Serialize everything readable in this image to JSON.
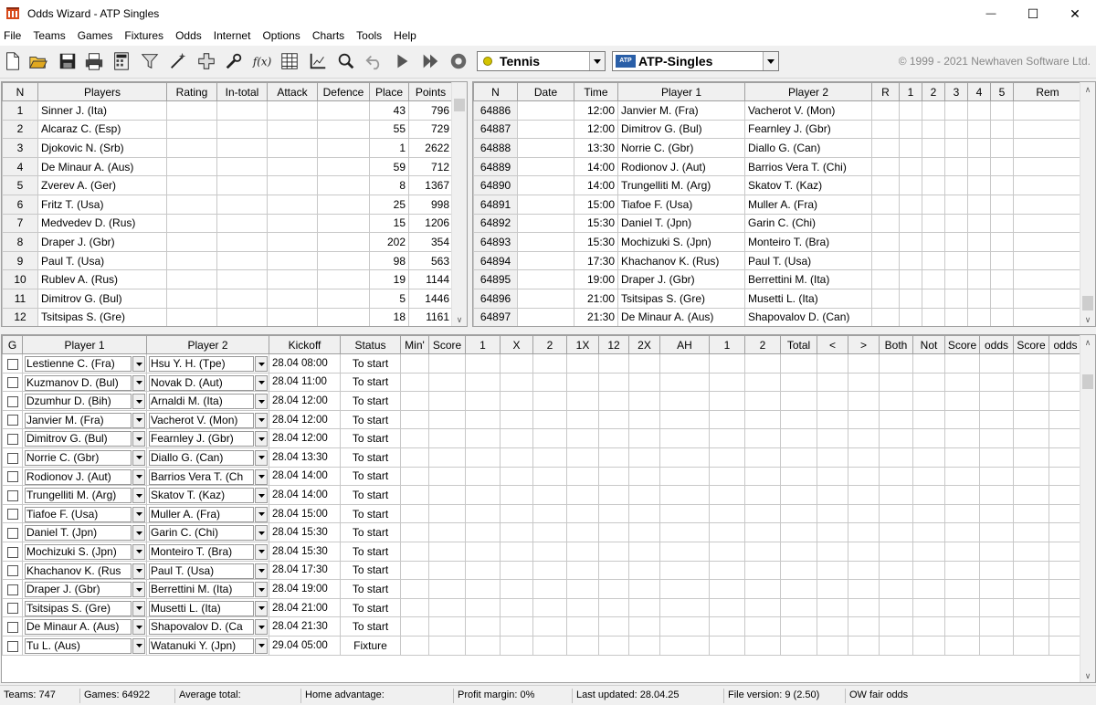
{
  "window": {
    "title": "Odds Wizard - ATP Singles",
    "minimize_glyph": "—",
    "maximize_glyph": "☐",
    "close_glyph": "✕"
  },
  "menu": [
    "File",
    "Teams",
    "Games",
    "Fixtures",
    "Odds",
    "Internet",
    "Options",
    "Charts",
    "Tools",
    "Help"
  ],
  "toolbar": {
    "icons": [
      "new-file-icon",
      "open-folder-icon",
      "save-icon",
      "print-icon",
      "calculator-icon",
      "filter-icon",
      "magic-wand-icon",
      "add-icon",
      "tools-icon",
      "formula-icon",
      "table-icon",
      "graph-icon",
      "search-icon",
      "undo-icon",
      "play-icon",
      "fast-forward-icon",
      "settings-icon"
    ],
    "sport_select": "Tennis",
    "league_select": "ATP-Singles",
    "league_badge": "ATP",
    "copyright": "© 1999 - 2021 Newhaven Software Ltd."
  },
  "teams_table": {
    "headers": [
      "N",
      "Players",
      "Rating",
      "In-total",
      "Attack",
      "Defence",
      "Place",
      "Points"
    ],
    "rows": [
      [
        "1",
        "Sinner J. (Ita)",
        "",
        "",
        "",
        "",
        "43",
        "796"
      ],
      [
        "2",
        "Alcaraz C. (Esp)",
        "",
        "",
        "",
        "",
        "55",
        "729"
      ],
      [
        "3",
        "Djokovic N. (Srb)",
        "",
        "",
        "",
        "",
        "1",
        "2622"
      ],
      [
        "4",
        "De Minaur A. (Aus)",
        "",
        "",
        "",
        "",
        "59",
        "712"
      ],
      [
        "5",
        "Zverev A. (Ger)",
        "",
        "",
        "",
        "",
        "8",
        "1367"
      ],
      [
        "6",
        "Fritz T. (Usa)",
        "",
        "",
        "",
        "",
        "25",
        "998"
      ],
      [
        "7",
        "Medvedev D. (Rus)",
        "",
        "",
        "",
        "",
        "15",
        "1206"
      ],
      [
        "8",
        "Draper J. (Gbr)",
        "",
        "",
        "",
        "",
        "202",
        "354"
      ],
      [
        "9",
        "Paul T. (Usa)",
        "",
        "",
        "",
        "",
        "98",
        "563"
      ],
      [
        "10",
        "Rublev A. (Rus)",
        "",
        "",
        "",
        "",
        "19",
        "1144"
      ],
      [
        "11",
        "Dimitrov G. (Bul)",
        "",
        "",
        "",
        "",
        "5",
        "1446"
      ],
      [
        "12",
        "Tsitsipas S. (Gre)",
        "",
        "",
        "",
        "",
        "18",
        "1161"
      ]
    ]
  },
  "games_table": {
    "headers": [
      "N",
      "Date",
      "Time",
      "Player 1",
      "Player 2",
      "R",
      "1",
      "2",
      "3",
      "4",
      "5",
      "Rem"
    ],
    "rows": [
      [
        "64886",
        "",
        "12:00",
        "Janvier M. (Fra)",
        "Vacherot V. (Mon)"
      ],
      [
        "64887",
        "",
        "12:00",
        "Dimitrov G. (Bul)",
        "Fearnley J. (Gbr)"
      ],
      [
        "64888",
        "",
        "13:30",
        "Norrie C. (Gbr)",
        "Diallo G. (Can)"
      ],
      [
        "64889",
        "",
        "14:00",
        "Rodionov J. (Aut)",
        "Barrios Vera T. (Chi)"
      ],
      [
        "64890",
        "",
        "14:00",
        "Trungelliti M. (Arg)",
        "Skatov T. (Kaz)"
      ],
      [
        "64891",
        "",
        "15:00",
        "Tiafoe F. (Usa)",
        "Muller A. (Fra)"
      ],
      [
        "64892",
        "",
        "15:30",
        "Daniel T. (Jpn)",
        "Garin C. (Chi)"
      ],
      [
        "64893",
        "",
        "15:30",
        "Mochizuki S. (Jpn)",
        "Monteiro T. (Bra)"
      ],
      [
        "64894",
        "",
        "17:30",
        "Khachanov K. (Rus)",
        "Paul T. (Usa)"
      ],
      [
        "64895",
        "",
        "19:00",
        "Draper J. (Gbr)",
        "Berrettini M. (Ita)"
      ],
      [
        "64896",
        "",
        "21:00",
        "Tsitsipas S. (Gre)",
        "Musetti L. (Ita)"
      ],
      [
        "64897",
        "",
        "21:30",
        "De Minaur A. (Aus)",
        "Shapovalov D. (Can)"
      ]
    ]
  },
  "fixtures_table": {
    "headers": [
      "G",
      "Player 1",
      "Player 2",
      "Kickoff",
      "Status",
      "Min'",
      "Score",
      "1",
      "X",
      "2",
      "1X",
      "12",
      "2X",
      "AH",
      "1",
      "2",
      "Total",
      "<",
      ">",
      "Both",
      "Not",
      "Score",
      "odds",
      "Score",
      "odds"
    ],
    "rows": [
      [
        "Lestienne C. (Fra)",
        "Hsu Y. H. (Tpe)",
        "28.04 08:00",
        "To start"
      ],
      [
        "Kuzmanov D. (Bul)",
        "Novak D. (Aut)",
        "28.04 11:00",
        "To start"
      ],
      [
        "Dzumhur D. (Bih)",
        "Arnaldi M. (Ita)",
        "28.04 12:00",
        "To start"
      ],
      [
        "Janvier M. (Fra)",
        "Vacherot V. (Mon)",
        "28.04 12:00",
        "To start"
      ],
      [
        "Dimitrov G. (Bul)",
        "Fearnley J. (Gbr)",
        "28.04 12:00",
        "To start"
      ],
      [
        "Norrie C. (Gbr)",
        "Diallo G. (Can)",
        "28.04 13:30",
        "To start"
      ],
      [
        "Rodionov J. (Aut)",
        "Barrios Vera T. (Ch",
        "28.04 14:00",
        "To start"
      ],
      [
        "Trungelliti M. (Arg)",
        "Skatov T. (Kaz)",
        "28.04 14:00",
        "To start"
      ],
      [
        "Tiafoe F. (Usa)",
        "Muller A. (Fra)",
        "28.04 15:00",
        "To start"
      ],
      [
        "Daniel T. (Jpn)",
        "Garin C. (Chi)",
        "28.04 15:30",
        "To start"
      ],
      [
        "Mochizuki S. (Jpn)",
        "Monteiro T. (Bra)",
        "28.04 15:30",
        "To start"
      ],
      [
        "Khachanov K. (Rus",
        "Paul T. (Usa)",
        "28.04 17:30",
        "To start"
      ],
      [
        "Draper J. (Gbr)",
        "Berrettini M. (Ita)",
        "28.04 19:00",
        "To start"
      ],
      [
        "Tsitsipas S. (Gre)",
        "Musetti L. (Ita)",
        "28.04 21:00",
        "To start"
      ],
      [
        "De Minaur A. (Aus)",
        "Shapovalov D. (Ca",
        "28.04 21:30",
        "To start"
      ],
      [
        "Tu L. (Aus)",
        "Watanuki Y. (Jpn)",
        "29.04 05:00",
        "Fixture"
      ]
    ]
  },
  "statusbar": {
    "teams": "Teams: 747",
    "games": "Games: 64922",
    "average_total": "Average total:",
    "home_advantage": "Home advantage:",
    "profit_margin": "Profit margin: 0%",
    "last_updated": "Last updated: 28.04.25",
    "file_version": "File version: 9 (2.50)",
    "mode": "OW fair odds"
  },
  "colors": {
    "sport_ball": "#d4c400",
    "atp_badge": "#2a5fa8"
  }
}
